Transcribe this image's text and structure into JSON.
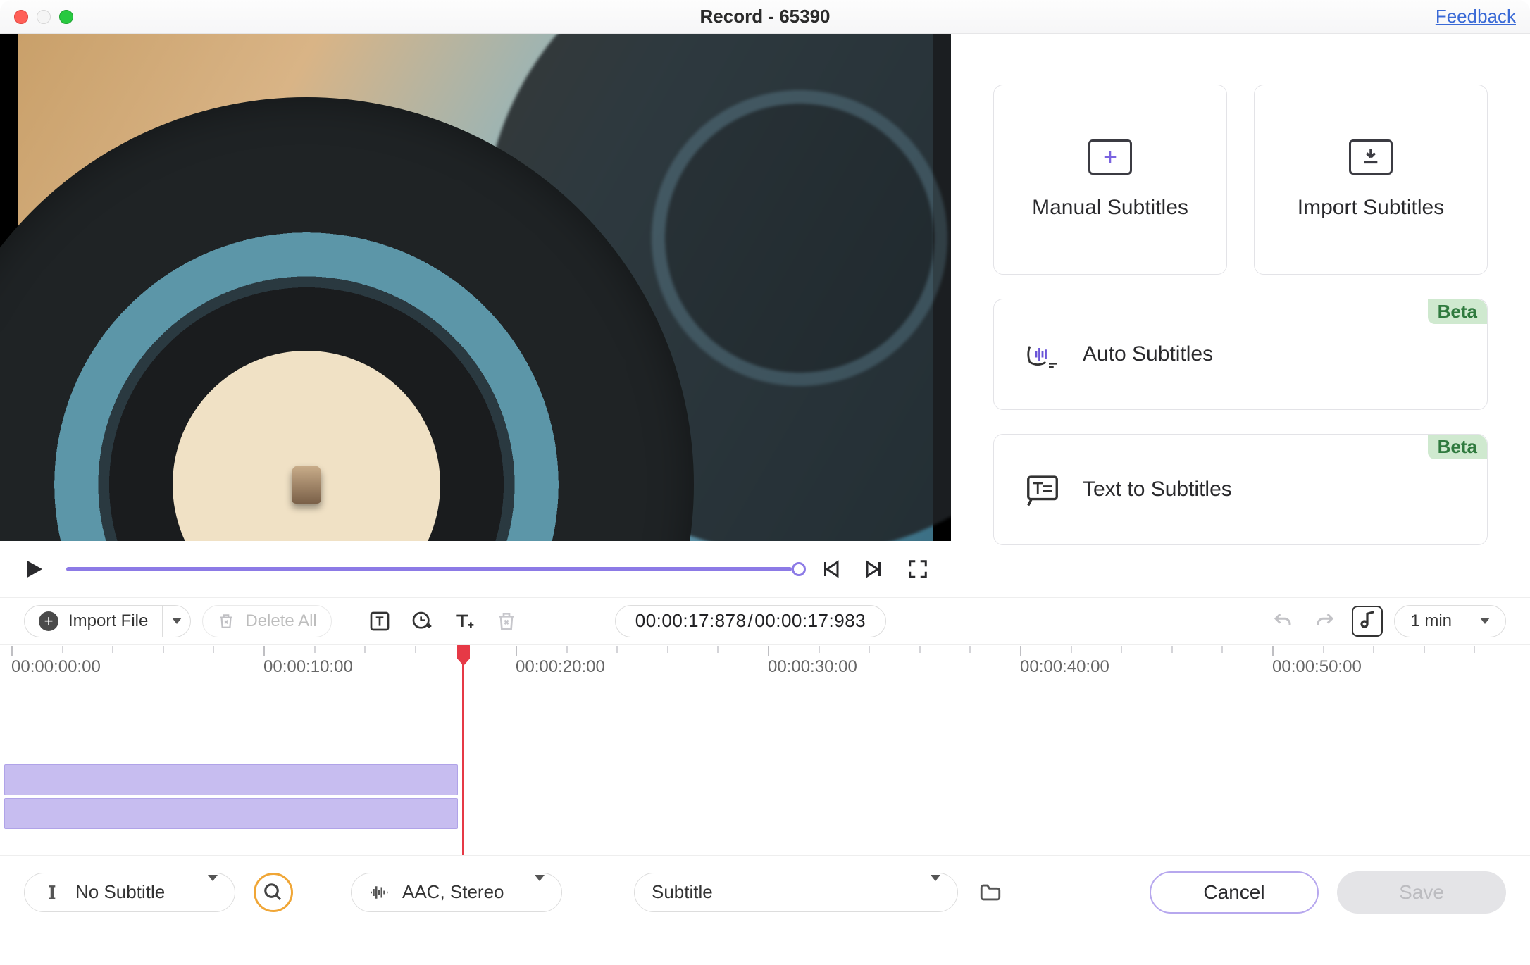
{
  "window": {
    "title": "Record - 65390",
    "feedback_label": "Feedback"
  },
  "subtitle_options": {
    "manual": "Manual Subtitles",
    "import": "Import Subtitles",
    "auto": "Auto Subtitles",
    "t2s": "Text to Subtitles",
    "beta_badge": "Beta"
  },
  "toolbar": {
    "import_file": "Import File",
    "delete_all": "Delete All",
    "time_current": "00:00:17:878",
    "time_total": "00:00:17:983",
    "zoom": "1 min"
  },
  "timeline": {
    "ticks": [
      "00:00:00:00",
      "00:00:10:00",
      "00:00:20:00",
      "00:00:30:00",
      "00:00:40:00",
      "00:00:50:00"
    ],
    "playhead_ratio": 0.298,
    "clip_end_ratio": 0.298
  },
  "footer": {
    "subtitle_track": "No Subtitle",
    "audio": "AAC, Stereo",
    "subtitle_dest": "Subtitle",
    "cancel": "Cancel",
    "save": "Save"
  }
}
